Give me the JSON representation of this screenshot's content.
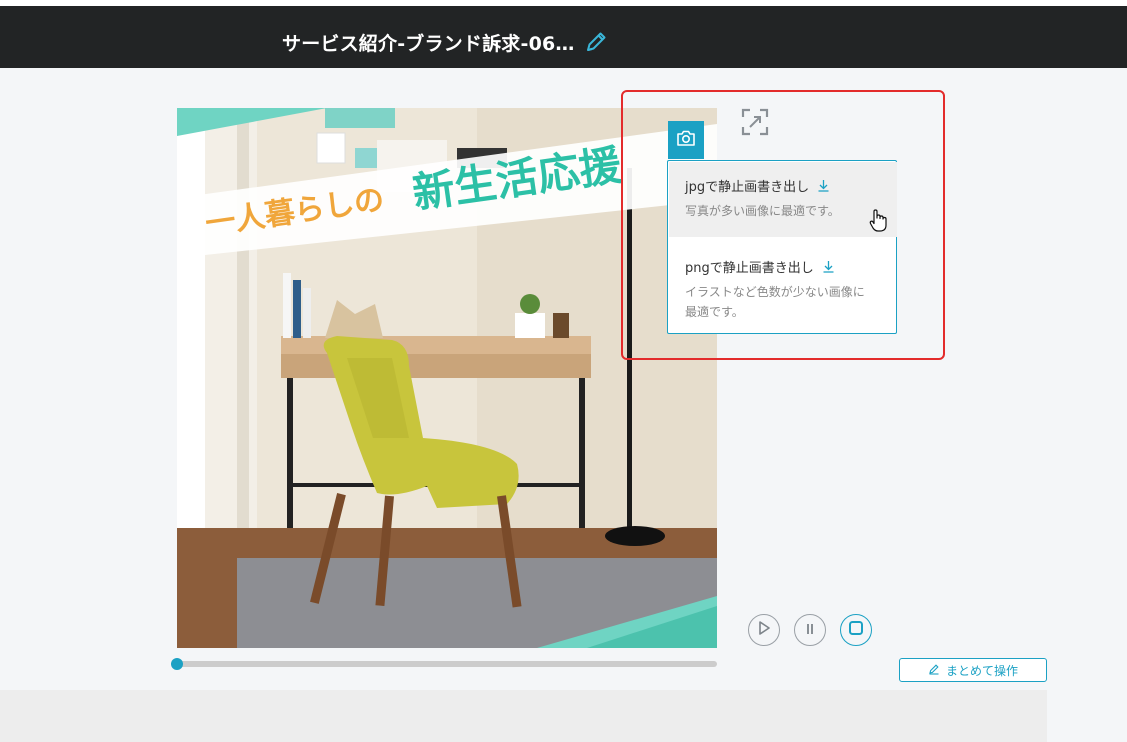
{
  "header": {
    "title": "サービス紹介-ブランド訴求-06…"
  },
  "video": {
    "banner_left": "一人暮らしの",
    "banner_right": "新生活応援"
  },
  "export_menu": {
    "items": [
      {
        "label": "jpgで静止画書き出し",
        "description": "写真が多い画像に最適です。"
      },
      {
        "label": "pngで静止画書き出し",
        "description_line1": "イラストなど色数が少ない画像に",
        "description_line2": "最適です。"
      }
    ]
  },
  "controls": {
    "play_icon": "play-icon",
    "pause_icon": "pause-icon",
    "stop_icon": "stop-icon"
  },
  "batch_button": {
    "label": "まとめて操作"
  },
  "playback": {
    "progress": 0
  },
  "colors": {
    "accent": "#1ba1c4",
    "header_bg": "#222425",
    "highlight": "#e32b2b",
    "banner_orange": "#f0a63b",
    "banner_teal": "#2cc0a6"
  }
}
